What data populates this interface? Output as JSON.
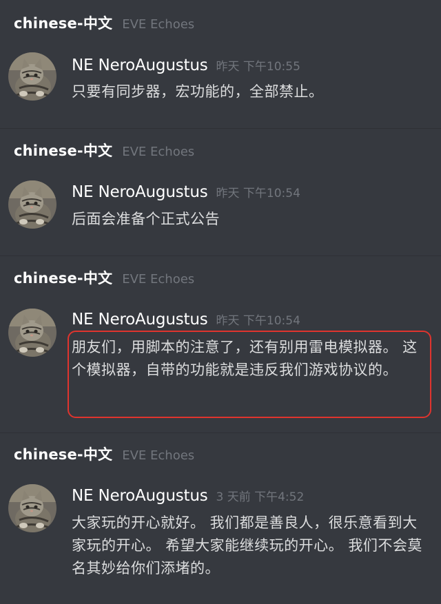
{
  "messages": [
    {
      "channel": "chinese-中文",
      "server": "EVE Echoes",
      "author": "NE NeroAugustus",
      "time": "昨天 下午10:55",
      "text": "只要有同步器，宏功能的，全部禁止。"
    },
    {
      "channel": "chinese-中文",
      "server": "EVE Echoes",
      "author": "NE NeroAugustus",
      "time": "昨天 下午10:54",
      "text": "后面会准备个正式公告"
    },
    {
      "channel": "chinese-中文",
      "server": "EVE Echoes",
      "author": "NE NeroAugustus",
      "time": "昨天 下午10:54",
      "text": "朋友们，用脚本的注意了，还有别用雷电模拟器。 这个模拟器，自带的功能就是违反我们游戏协议的。",
      "highlighted": true
    },
    {
      "channel": "chinese-中文",
      "server": "EVE Echoes",
      "author": "NE NeroAugustus",
      "time": "3 天前 下午4:52",
      "text": "大家玩的开心就好。 我们都是善良人，很乐意看到大家玩的开心。 希望大家能继续玩的开心。 我们不会莫名其妙给你们添堵的。"
    }
  ],
  "colors": {
    "background": "#36393f",
    "username": "#ffffff",
    "muted": "#72767d",
    "message_text": "#dcddde",
    "highlight_border": "#e0342e"
  },
  "icons": {
    "avatar": "cat-avatar-icon"
  }
}
